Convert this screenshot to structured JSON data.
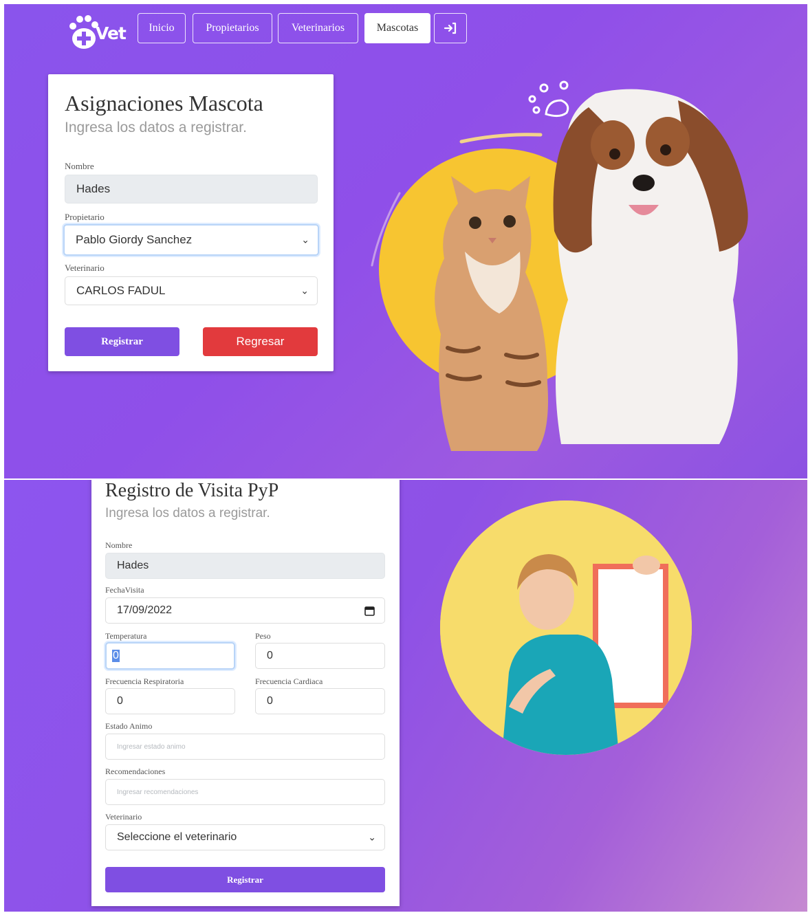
{
  "app": {
    "logo_text": "Vet"
  },
  "nav": {
    "items": [
      {
        "label": "Inicio"
      },
      {
        "label": "Propietarios"
      },
      {
        "label": "Veterinarios"
      },
      {
        "label": "Mascotas",
        "active": true
      }
    ],
    "exit_icon": "sign-in-icon"
  },
  "assign_form": {
    "title": "Asignaciones Mascota",
    "subtitle": "Ingresa los datos a registrar.",
    "nombre_label": "Nombre",
    "nombre_value": "Hades",
    "propietario_label": "Propietario",
    "propietario_value": "Pablo Giordy Sanchez",
    "veterinario_label": "Veterinario",
    "veterinario_value": "CARLOS FADUL",
    "register_label": "Registrar",
    "back_label": "Regresar"
  },
  "visit_form": {
    "title": "Registro de Visita PyP",
    "subtitle": "Ingresa los datos a registrar.",
    "nombre_label": "Nombre",
    "nombre_value": "Hades",
    "fecha_label": "FechaVisita",
    "fecha_value": "17/09/2022",
    "temperatura_label": "Temperatura",
    "temperatura_value": "0",
    "peso_label": "Peso",
    "peso_value": "0",
    "frec_resp_label": "Frecuencia Respiratoria",
    "frec_resp_value": "0",
    "frec_card_label": "Frecuencia Cardiaca",
    "frec_card_value": "0",
    "estado_label": "Estado Animo",
    "estado_placeholder": "Ingresar estado animo",
    "recom_label": "Recomendaciones",
    "recom_placeholder": "Ingresar recomendaciones",
    "veterinario_label": "Veterinario",
    "veterinario_value": "Seleccione el veterinario",
    "register_label": "Registrar"
  },
  "colors": {
    "brand_purple": "#8a54ec",
    "button_purple": "#7f4fe2",
    "button_red": "#e23a3d",
    "accent_yellow": "#f7c531"
  }
}
